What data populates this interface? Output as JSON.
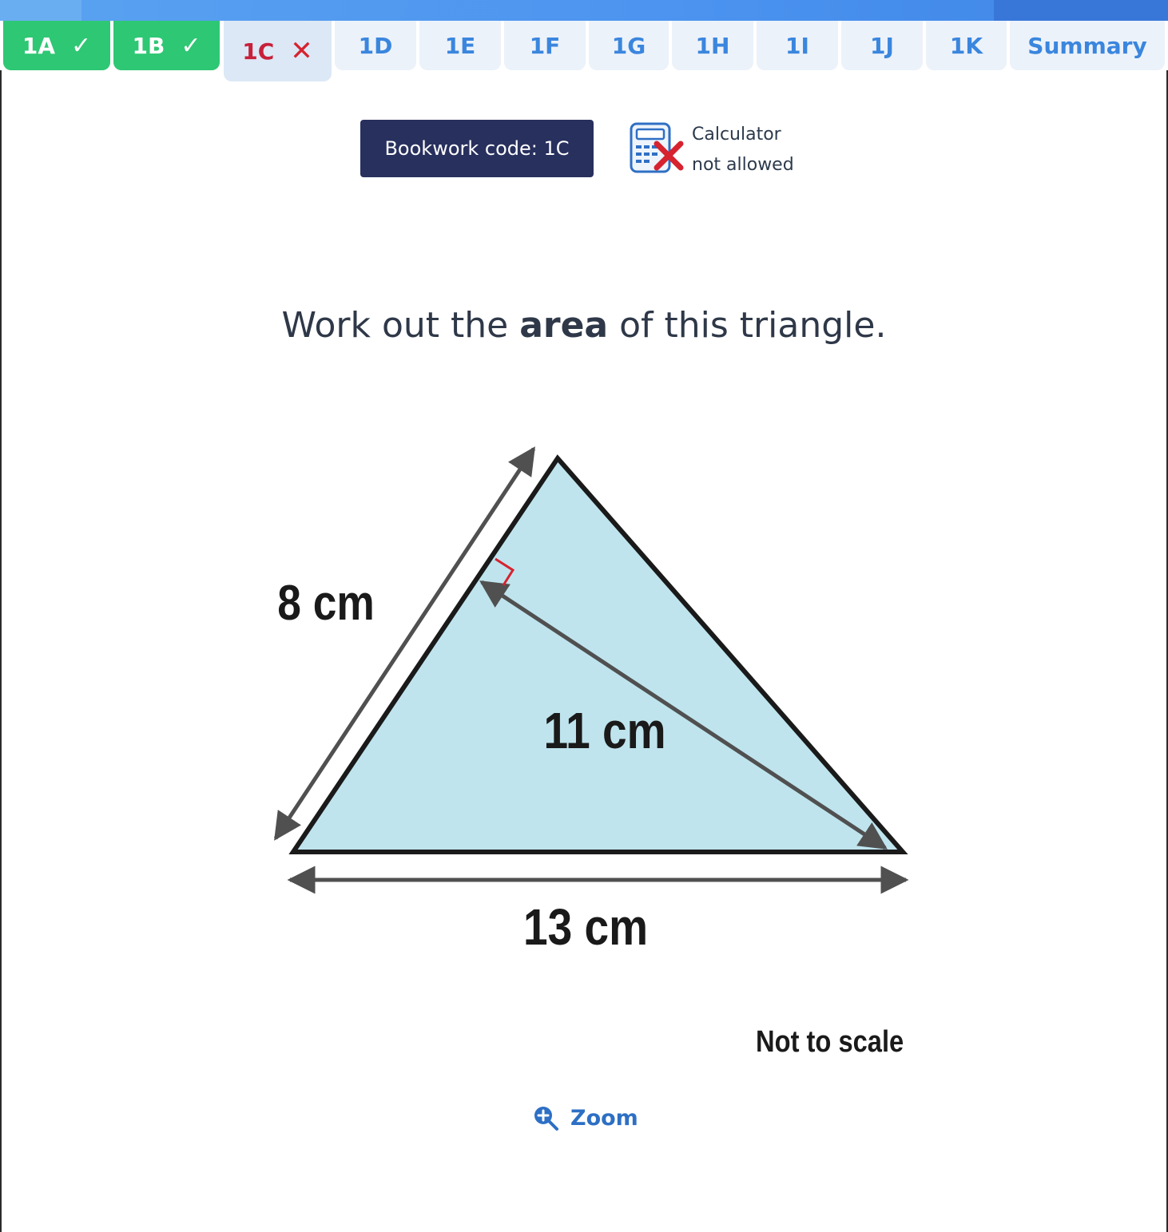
{
  "tabs": [
    {
      "label": "1A",
      "status": "correct",
      "mark": "✓"
    },
    {
      "label": "1B",
      "status": "correct",
      "mark": "✓"
    },
    {
      "label": "1C",
      "status": "incorrect",
      "mark": "✕"
    },
    {
      "label": "1D",
      "status": "pending",
      "mark": ""
    },
    {
      "label": "1E",
      "status": "pending",
      "mark": ""
    },
    {
      "label": "1F",
      "status": "pending",
      "mark": ""
    },
    {
      "label": "1G",
      "status": "pending",
      "mark": ""
    },
    {
      "label": "1H",
      "status": "pending",
      "mark": ""
    },
    {
      "label": "1I",
      "status": "pending",
      "mark": ""
    },
    {
      "label": "1J",
      "status": "pending",
      "mark": ""
    },
    {
      "label": "1K",
      "status": "pending",
      "mark": ""
    },
    {
      "label": "Summary",
      "status": "pending",
      "mark": ""
    }
  ],
  "bookwork": {
    "label": "Bookwork code: 1C"
  },
  "calculator": {
    "line1": "Calculator",
    "line2": "not allowed",
    "icon": "calculator-not-allowed-icon"
  },
  "question": {
    "before": "Work out the ",
    "bold": "area",
    "after": " of this triangle."
  },
  "diagram": {
    "side_label": "8 cm",
    "height_label": "11 cm",
    "base_label": "13 cm",
    "fill_color": "#bfe4ee",
    "outline_color": "#1a1a1a",
    "arrow_color": "#505050",
    "right_angle_color": "#d6232f"
  },
  "note": "Not to scale",
  "zoom": {
    "label": "Zoom",
    "icon": "zoom-in-icon"
  },
  "colors": {
    "correct": "#2ec774",
    "incorrect": "#d6232f",
    "pending_text": "#3a86de",
    "bookwork_bg": "#28305e"
  }
}
